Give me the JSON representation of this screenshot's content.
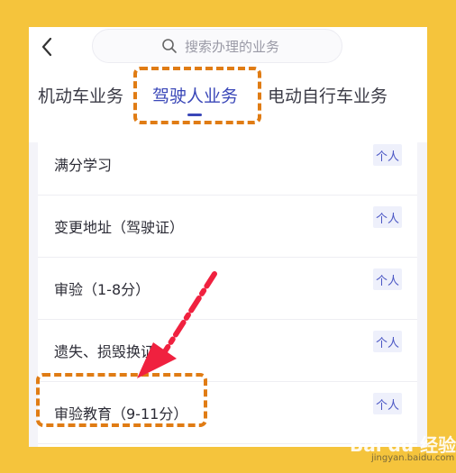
{
  "search": {
    "placeholder": "搜索办理的业务"
  },
  "tabs": [
    {
      "label": "机动车业务",
      "active": false
    },
    {
      "label": "驾驶人业务",
      "active": true
    },
    {
      "label": "电动自行车业务",
      "active": false
    }
  ],
  "items": [
    {
      "label": "满分学习",
      "badge": "个人"
    },
    {
      "label": "变更地址（驾驶证）",
      "badge": "个人"
    },
    {
      "label": "审验（1-8分）",
      "badge": "个人"
    },
    {
      "label": "遗失、损毁换证",
      "badge": "个人"
    },
    {
      "label": "审验教育（9-11分）",
      "badge": "个人"
    }
  ],
  "watermark": {
    "brand": "Bai du 经验",
    "url": "jingyan.baidu.com"
  },
  "colors": {
    "background": "#f5c43c",
    "active_tab": "#3a47b8",
    "highlight": "#e07c14",
    "arrow": "#f0213f"
  }
}
